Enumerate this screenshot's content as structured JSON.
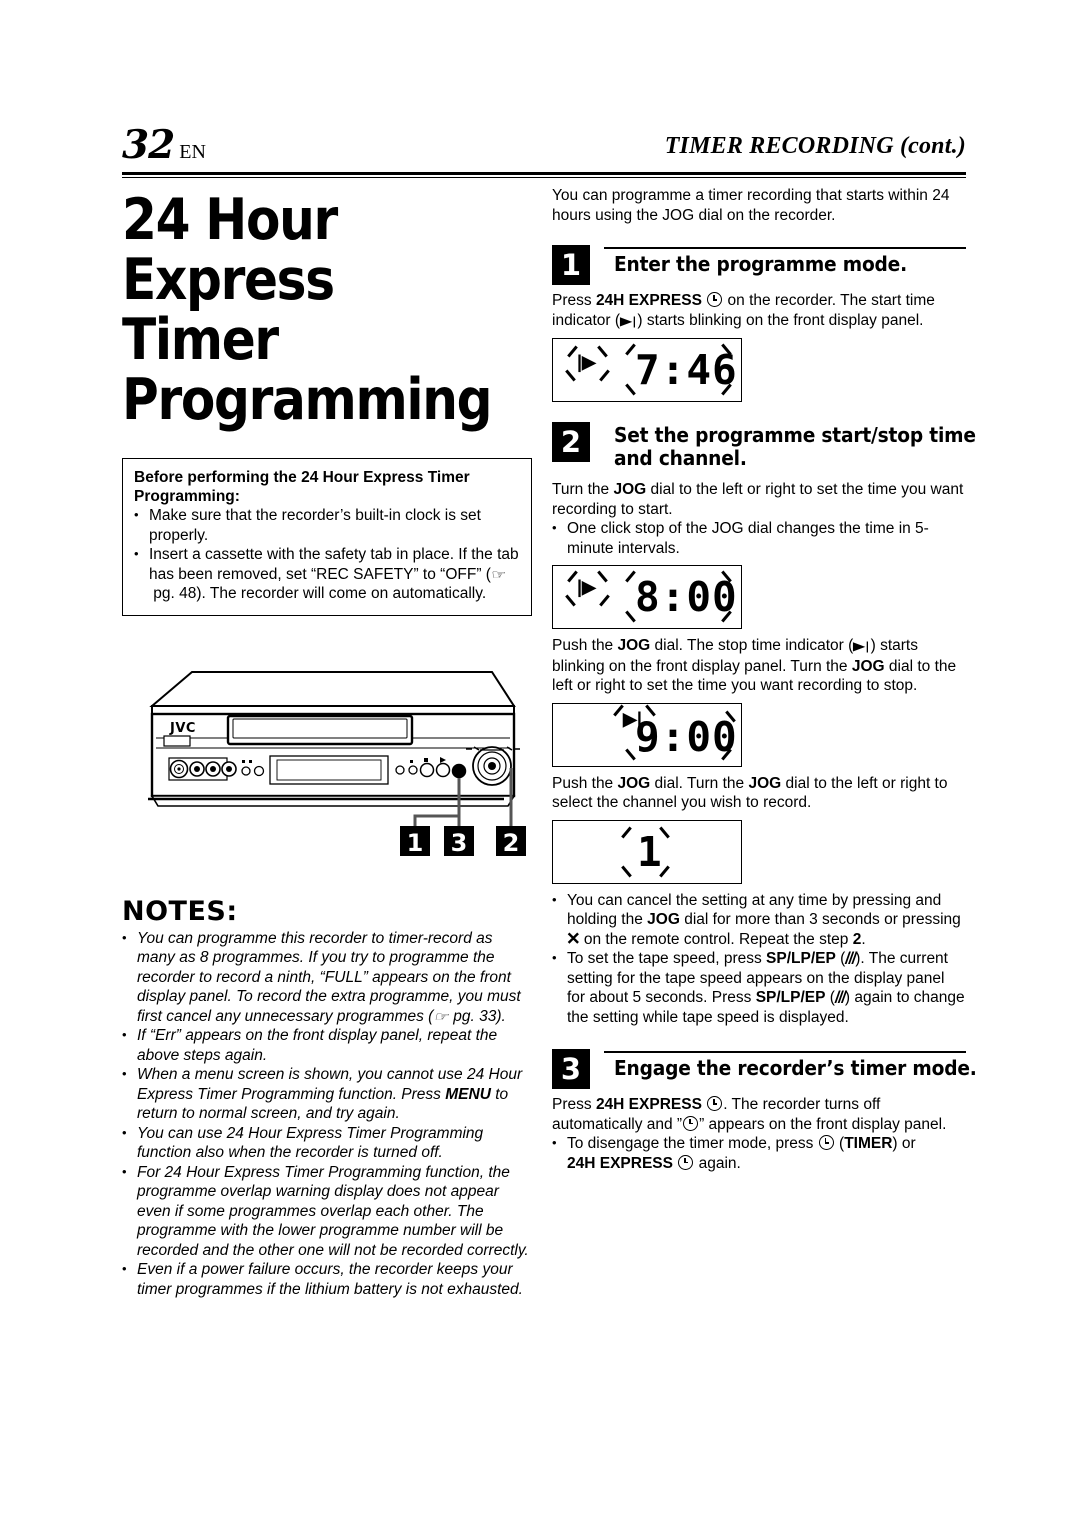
{
  "header": {
    "folio_number": "32",
    "folio_lang": "EN",
    "running_head": "TIMER RECORDING (cont.)"
  },
  "left_column": {
    "title_line1": "24 Hour Express",
    "title_line2": "Timer Programming",
    "before_box": {
      "title": "Before performing the 24 Hour Express Timer Programming:",
      "items": [
        "Make sure that the recorder’s built-in clock is set properly.",
        "Insert a cassette with the safety tab in place. If the tab has been removed, set “REC SAFETY” to “OFF” (☞ pg. 48). The recorder will come on automatically."
      ]
    },
    "illustration": {
      "brand": "JVC",
      "callouts": [
        "1",
        "3",
        "2"
      ]
    },
    "notes": {
      "heading": "NOTES:",
      "items": [
        "You can programme this recorder to timer-record as many as 8 programmes. If you try to programme the recorder to record a ninth, “FULL” appears on the front display panel. To record the extra programme, you must first cancel any unnecessary programmes (☞ pg. 33).",
        "If “Err” appears on the front display panel, repeat the above steps again.",
        "When a menu screen is shown, you cannot use 24 Hour Express Timer Programming function. Press MENU to return to normal screen, and try again.",
        "You can use 24 Hour Express Timer Programming function also when the recorder is turned off.",
        "For 24 Hour Express Timer Programming function, the programme overlap warning display does not appear even if some programmes overlap each other. The programme with the lower programme number will be recorded and the other one will not be recorded correctly.",
        "Even if a power failure occurs, the recorder keeps your timer programmes if the lithium battery is not exhausted."
      ]
    }
  },
  "right_column": {
    "intro": "You can programme a timer recording that starts within 24 hours using the JOG dial on the recorder.",
    "steps": [
      {
        "number": "1",
        "title": "Enter the programme mode.",
        "body_pre": "Press ",
        "body_bold": "24H EXPRESS",
        "body_post": " on the recorder. The start time indicator (",
        "body_post2": ") starts blinking on the front display panel.",
        "display": {
          "indicator": "start",
          "value": "7:46"
        }
      },
      {
        "number": "2",
        "title": "Set the programme start/stop time and channel.",
        "para1_pre": "Turn the ",
        "para1_bold": "JOG",
        "para1_post": " dial to the left or right to set the time you want recording to start.",
        "bullet1": "One click stop of the JOG dial changes the time in 5-minute intervals.",
        "display1": {
          "indicator": "start",
          "value": "8:00"
        },
        "para2": "Push the JOG dial. The stop time indicator ( ) starts blinking on the front display panel. Turn the JOG dial to the left or right to set the time you want recording to stop.",
        "display2": {
          "indicator": "stop",
          "value": "9:00"
        },
        "para3": "Push the JOG dial. Turn the JOG dial to the left or right to select the channel you wish to record.",
        "display3": {
          "indicator": "none",
          "value": "1"
        },
        "bullets": [
          "You can cancel the setting at any time by pressing and holding the JOG dial for more than 3 seconds or pressing × on the remote control. Repeat the step 2.",
          "To set the tape speed, press SP/LP/EP (///). The current setting for the tape speed appears on the display panel for about 5 seconds. Press SP/LP/EP (///) again to change the setting while tape speed is displayed."
        ]
      },
      {
        "number": "3",
        "title": "Engage the recorder’s timer mode.",
        "body": "Press 24H EXPRESS . The recorder turns off automatically and ” ” appears on the front display panel.",
        "bullet": "To disengage the timer mode, press (TIMER) or 24H EXPRESS again."
      }
    ]
  },
  "colors": {
    "ink": "#000000",
    "paper": "#ffffff",
    "panel_gray": "#e8e8e8"
  }
}
